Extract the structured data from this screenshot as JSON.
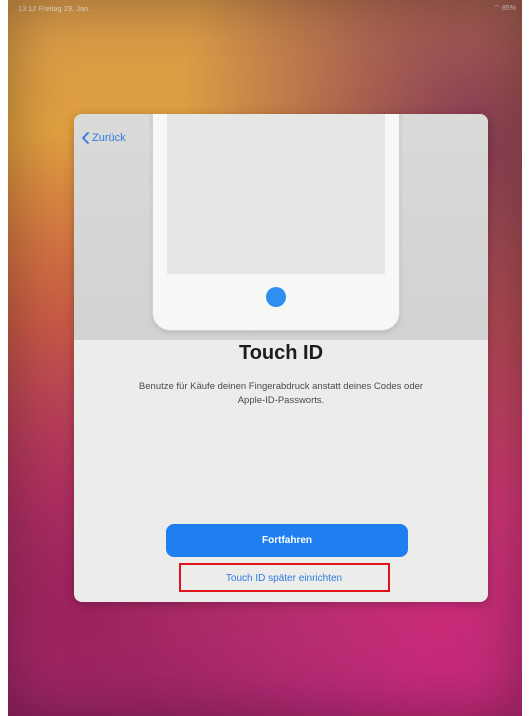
{
  "status_bar": {
    "time": "13:12",
    "date": "Freitag 29. Jan.",
    "right": "⌔ 85%"
  },
  "screen": {
    "back_label": "Zurück",
    "title": "Touch ID",
    "description": "Benutze für Käufe deinen Fingerabdruck anstatt deines Codes oder Apple-ID-Passworts.",
    "primary_button": "Fortfahren",
    "secondary_link": "Touch ID später einrichten"
  },
  "colors": {
    "accent": "#1f7ff0",
    "highlight": "#e0121e",
    "sheet": "#ececea"
  }
}
